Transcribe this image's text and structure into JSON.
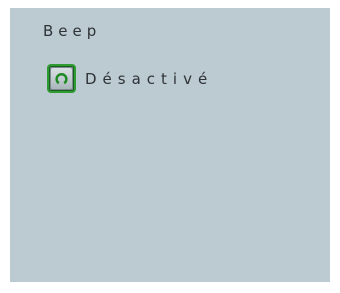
{
  "setting": {
    "title": "Beep",
    "state_label": "Désactivé",
    "toggle_icon": "power-cycle-icon"
  },
  "colors": {
    "panel_background": "#bccad1",
    "toggle_border": "#2e9c32",
    "text": "#2e3337"
  }
}
